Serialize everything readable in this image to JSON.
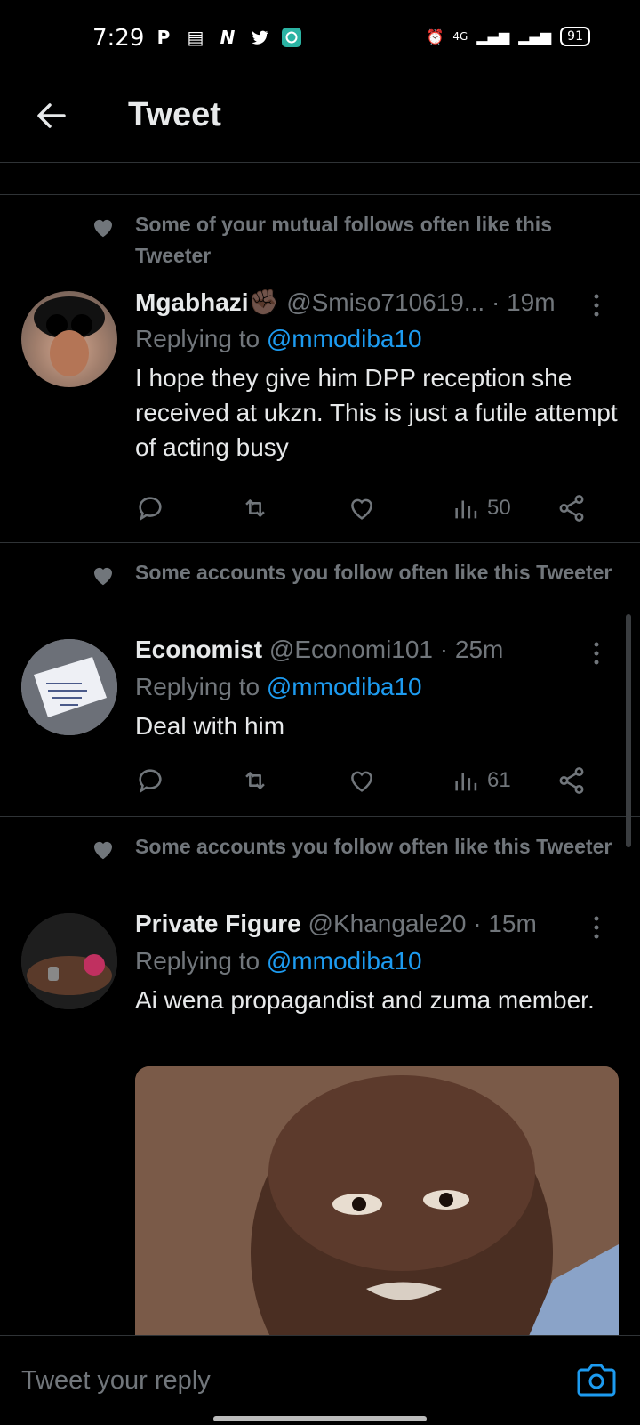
{
  "status": {
    "time": "7:29",
    "battery": "91",
    "network": "4G"
  },
  "header": {
    "title": "Tweet"
  },
  "tweets": [
    {
      "social": "Some of your mutual follows often like this Tweeter",
      "name": "Mgabhazi✊🏿",
      "handle": "@Smiso710619...",
      "time": "· 19m",
      "replying_prefix": "Replying to",
      "mention": "@mmodiba10",
      "text": "I hope they give him DPP reception she received at  ukzn. This is just a futile attempt of acting busy",
      "views": "50"
    },
    {
      "social": "Some accounts you follow often like this Tweeter",
      "name": "Economist",
      "handle": "@Economi101",
      "time": "· 25m",
      "replying_prefix": "Replying to",
      "mention": "@mmodiba10",
      "text": "Deal with him",
      "views": "61"
    },
    {
      "social": "Some accounts you follow often like this Tweeter",
      "name": "Private Figure",
      "handle": "@Khangale20",
      "time": "· 15m",
      "replying_prefix": "Replying to",
      "mention": "@mmodiba10",
      "text": "Ai wena propagandist and zuma member."
    }
  ],
  "reply": {
    "placeholder": "Tweet your reply"
  },
  "colors": {
    "accent": "#1d9bf0",
    "muted": "#71767b",
    "text": "#e7e9ea",
    "divider": "#2f3336"
  }
}
